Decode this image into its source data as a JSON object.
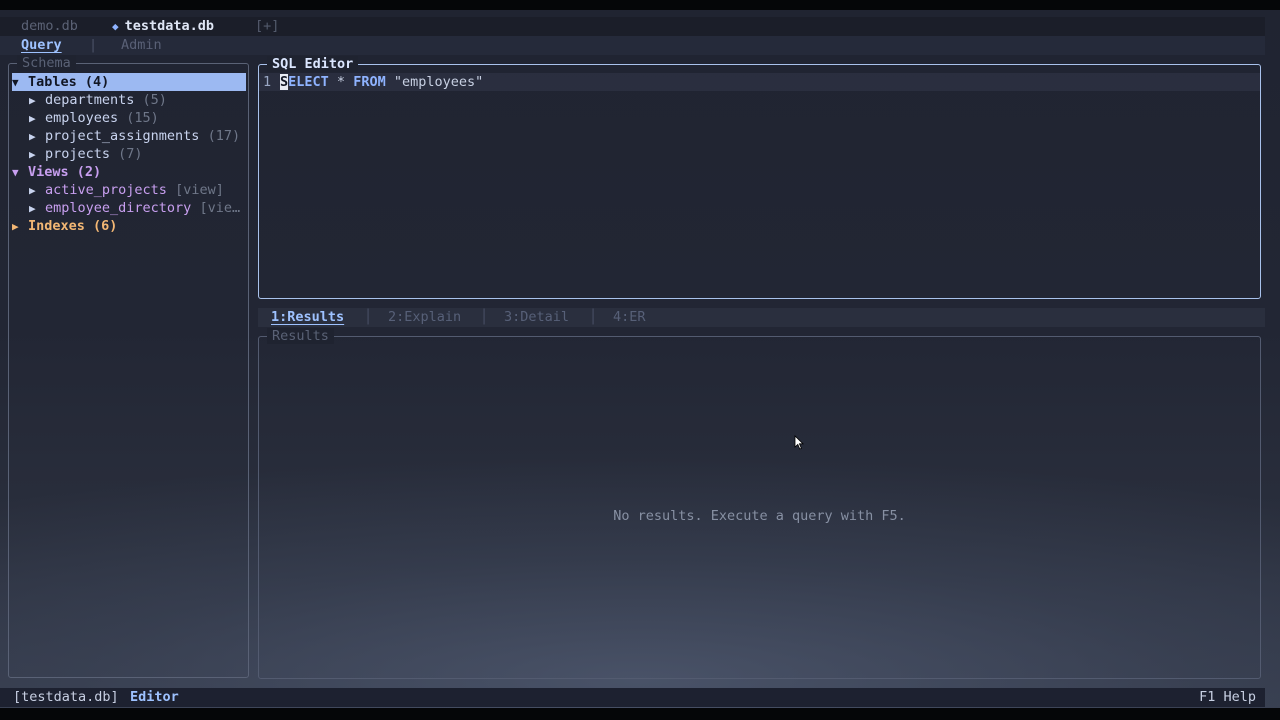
{
  "file_tabs": [
    {
      "label": "demo.db"
    },
    {
      "label": "testdata.db"
    },
    {
      "label": "[+]"
    }
  ],
  "mode_tabs": {
    "query": "Query",
    "separator": "|",
    "admin": "Admin"
  },
  "schema": {
    "title": "Schema",
    "tables_group": "Tables (4)",
    "tables": [
      {
        "name": "departments",
        "count": "(5)"
      },
      {
        "name": "employees",
        "count": "(15)"
      },
      {
        "name": "project_assignments",
        "count": "(17)"
      },
      {
        "name": "projects",
        "count": "(7)"
      }
    ],
    "views_group": "Views (2)",
    "views": [
      {
        "name": "active_projects",
        "tag": "[view]"
      },
      {
        "name": "employee_directory",
        "tag": "[vie…"
      }
    ],
    "indexes_group": "Indexes (6)"
  },
  "editor": {
    "title": "SQL Editor",
    "line_number": "1",
    "query": {
      "cursor_char": "S",
      "kw1_rest": "ELECT",
      "star": "*",
      "kw2": "FROM",
      "table": "\"employees\""
    }
  },
  "result_tabs": [
    {
      "label": "1:Results"
    },
    {
      "label": "2:Explain"
    },
    {
      "label": "3:Detail"
    },
    {
      "label": "4:ER"
    }
  ],
  "results": {
    "title": "Results",
    "empty_message": "No results. Execute a query with F5."
  },
  "status": {
    "db": "[testdata.db]",
    "mode": "Editor",
    "help": "F1 Help"
  },
  "icons": {
    "expanded": "triangle-down-icon",
    "collapsed": "triangle-right-icon",
    "active_file": "diamond-icon"
  },
  "colors": {
    "accent": "#9ec2ff",
    "selection": "#9cb9f2",
    "views": "#c89ff0",
    "indexes": "#f3b774"
  }
}
